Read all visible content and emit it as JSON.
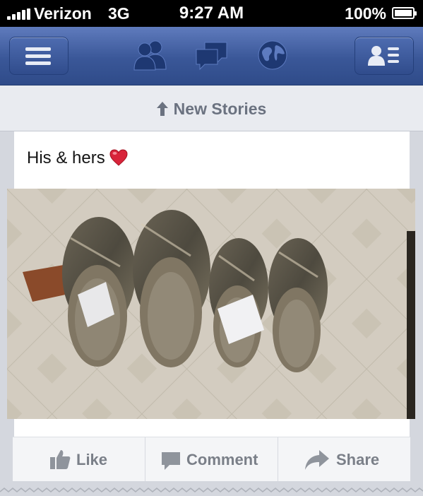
{
  "status_bar": {
    "carrier": "Verizon",
    "network": "3G",
    "time": "9:27 AM",
    "battery": "100%"
  },
  "nav": {
    "icons": [
      "menu-icon",
      "friend-requests-icon",
      "messages-icon",
      "notifications-globe-icon",
      "contacts-list-icon"
    ]
  },
  "new_stories": {
    "label": "New Stories"
  },
  "post": {
    "text": "His & hers",
    "emoji": "heart-emoji"
  },
  "actions": {
    "like": "Like",
    "comment": "Comment",
    "share": "Share"
  },
  "colors": {
    "nav_blue": "#3a5798",
    "action_text": "#7a7f88",
    "new_stories_text": "#6b7280"
  }
}
